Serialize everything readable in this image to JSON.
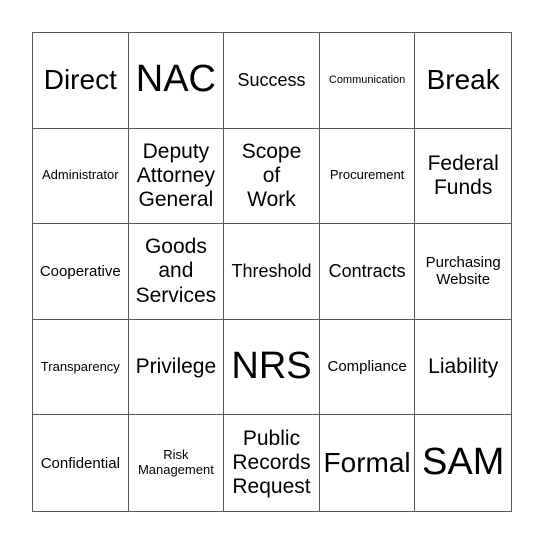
{
  "board": {
    "cells": [
      {
        "text": "Direct",
        "size": "2xl"
      },
      {
        "text": "NAC",
        "size": "3xl"
      },
      {
        "text": "Success",
        "size": "lg"
      },
      {
        "text": "Communication",
        "size": "xs"
      },
      {
        "text": "Break",
        "size": "2xl"
      },
      {
        "text": "Administrator",
        "size": "sm"
      },
      {
        "text": "Deputy Attorney General",
        "size": "xl"
      },
      {
        "text": "Scope of Work",
        "size": "xl"
      },
      {
        "text": "Procurement",
        "size": "sm"
      },
      {
        "text": "Federal Funds",
        "size": "xl"
      },
      {
        "text": "Cooperative",
        "size": "md"
      },
      {
        "text": "Goods and Services",
        "size": "xl"
      },
      {
        "text": "Threshold",
        "size": "lg"
      },
      {
        "text": "Contracts",
        "size": "lg"
      },
      {
        "text": "Purchasing Website",
        "size": "md"
      },
      {
        "text": "Transparency",
        "size": "sm"
      },
      {
        "text": "Privilege",
        "size": "xl"
      },
      {
        "text": "NRS",
        "size": "3xl"
      },
      {
        "text": "Compliance",
        "size": "md"
      },
      {
        "text": "Liability",
        "size": "xl"
      },
      {
        "text": "Confidential",
        "size": "md"
      },
      {
        "text": "Risk Management",
        "size": "sm"
      },
      {
        "text": "Public Records Request",
        "size": "xl"
      },
      {
        "text": "Formal",
        "size": "2xl"
      },
      {
        "text": "SAM",
        "size": "3xl"
      }
    ]
  }
}
